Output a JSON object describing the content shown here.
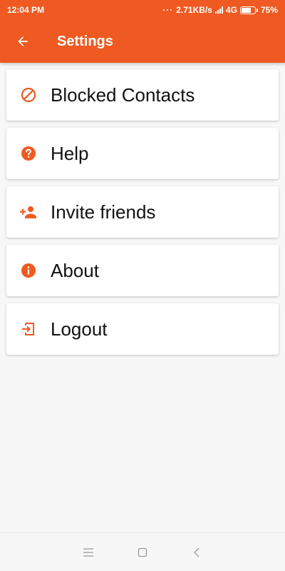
{
  "status_bar": {
    "time": "12:04 PM",
    "network_speed": "2.71KB/s",
    "network_type": "4G",
    "battery": "75%",
    "battery_level": 0.75
  },
  "app_bar": {
    "title": "Settings",
    "back_icon": "arrow-back-icon",
    "color": "#ef5a22"
  },
  "menu": {
    "items": [
      {
        "label": "Blocked Contacts",
        "icon": "block-icon"
      },
      {
        "label": "Help",
        "icon": "help-icon"
      },
      {
        "label": "Invite friends",
        "icon": "person-add-icon"
      },
      {
        "label": "About",
        "icon": "info-icon"
      },
      {
        "label": "Logout",
        "icon": "logout-icon"
      }
    ]
  },
  "nav_bar": {
    "icons": [
      "menu-icon",
      "home-icon",
      "back-icon"
    ]
  }
}
